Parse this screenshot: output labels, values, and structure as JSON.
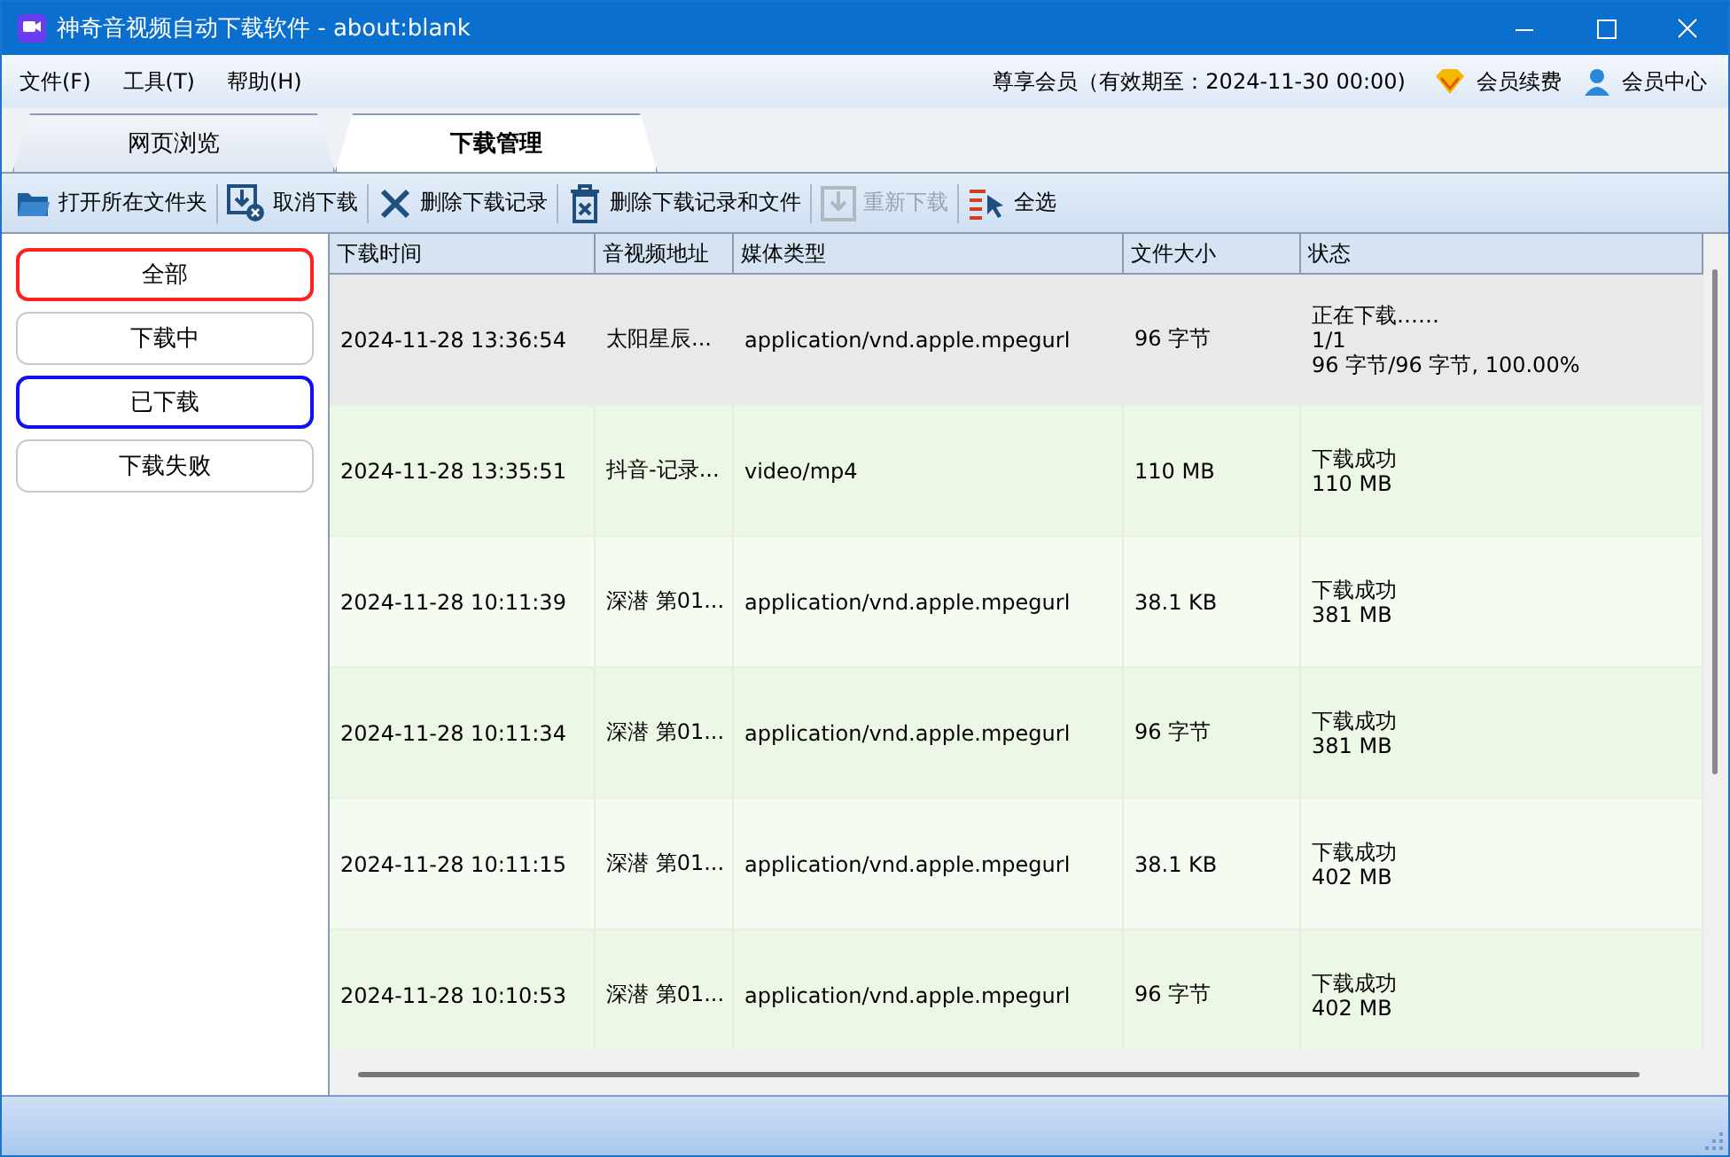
{
  "window": {
    "title": "神奇音视频自动下载软件 - about:blank"
  },
  "menu": [
    "文件(F)",
    "工具(T)",
    "帮助(H)"
  ],
  "membership": {
    "text": "尊享会员（有效期至：2024-11-30 00:00)",
    "renew": "会员续费",
    "center": "会员中心"
  },
  "tabs": [
    {
      "label": "网页浏览",
      "selected": false
    },
    {
      "label": "下载管理",
      "selected": true
    }
  ],
  "toolbar": [
    {
      "kind": "folder",
      "label": "打开所在文件夹",
      "disabled": false
    },
    {
      "kind": "cancel",
      "label": "取消下载",
      "disabled": false
    },
    {
      "kind": "delete",
      "label": "删除下载记录",
      "disabled": false
    },
    {
      "kind": "trash",
      "label": "删除下载记录和文件",
      "disabled": false
    },
    {
      "kind": "redownload",
      "label": "重新下载",
      "disabled": true
    },
    {
      "kind": "selectall",
      "label": "全选",
      "disabled": false
    }
  ],
  "filters": [
    {
      "label": "全部",
      "selected": true,
      "focused": false
    },
    {
      "label": "下载中",
      "selected": false,
      "focused": false
    },
    {
      "label": "已下载",
      "selected": false,
      "focused": true
    },
    {
      "label": "下载失败",
      "selected": false,
      "focused": false
    }
  ],
  "table": {
    "columns": [
      "下载时间",
      "音视频地址",
      "媒体类型",
      "文件大小",
      "状态"
    ],
    "rows": [
      {
        "selected": true,
        "time": "2024-11-28 13:36:54",
        "address": "太阳星辰...",
        "type": "application/vnd.apple.mpegurl",
        "size": "96 字节",
        "status": [
          "正在下载……",
          "1/1",
          "96 字节/96 字节, 100.00%"
        ]
      },
      {
        "selected": false,
        "time": "2024-11-28 13:35:51",
        "address": "抖音-记录...",
        "type": "video/mp4",
        "size": "110 MB",
        "status": [
          "下载成功",
          "110 MB"
        ]
      },
      {
        "selected": false,
        "time": "2024-11-28 10:11:39",
        "address": "深潜 第01...",
        "type": "application/vnd.apple.mpegurl",
        "size": "38.1 KB",
        "status": [
          "下载成功",
          "381 MB"
        ]
      },
      {
        "selected": false,
        "time": "2024-11-28 10:11:34",
        "address": "深潜 第01...",
        "type": "application/vnd.apple.mpegurl",
        "size": "96 字节",
        "status": [
          "下载成功",
          "381 MB"
        ]
      },
      {
        "selected": false,
        "time": "2024-11-28 10:11:15",
        "address": "深潜 第01...",
        "type": "application/vnd.apple.mpegurl",
        "size": "38.1 KB",
        "status": [
          "下载成功",
          "402 MB"
        ]
      },
      {
        "selected": false,
        "time": "2024-11-28 10:10:53",
        "address": "深潜 第01...",
        "type": "application/vnd.apple.mpegurl",
        "size": "96 字节",
        "status": [
          "下载成功",
          "402 MB"
        ]
      }
    ]
  }
}
